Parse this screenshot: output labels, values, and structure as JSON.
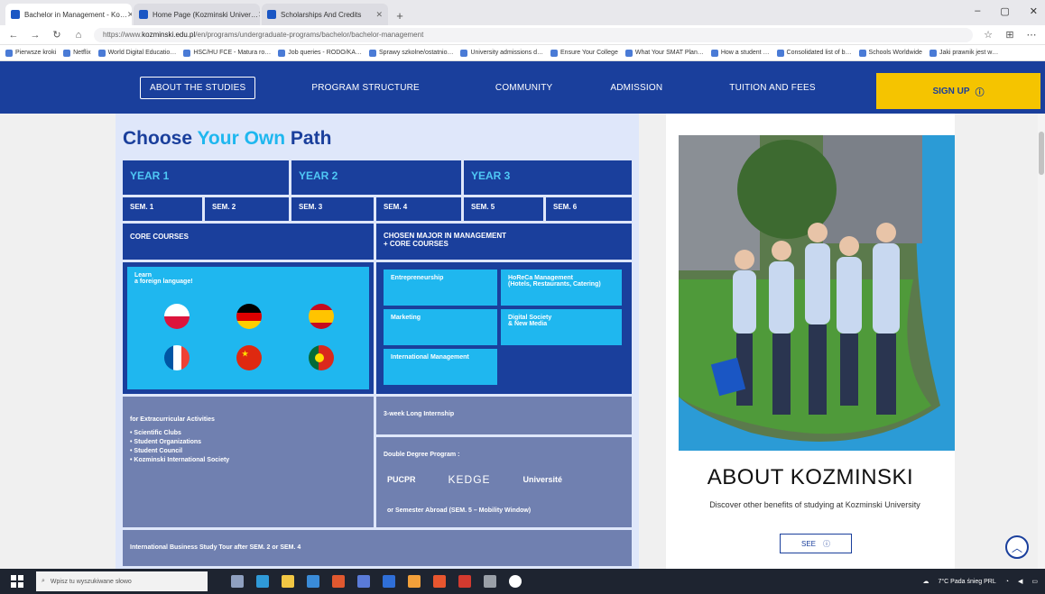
{
  "browser": {
    "tabs": [
      {
        "label": "Bachelor in Management - Ko…",
        "active": true
      },
      {
        "label": "Home Page (Kozminski Univer…",
        "active": false
      },
      {
        "label": "Scholarships And Credits",
        "active": false
      }
    ],
    "url_prefix": "https://www.",
    "url_domain": "kozminski.edu.pl",
    "url_path": "/en/programs/undergraduate-programs/bachelor/bachelor-management",
    "bookmarks": [
      "Pierwsze kroki",
      "Netflix",
      "World Digital Educatio…",
      "HSC/HU FCE - Matura ro…",
      "Job queries - RODO/KA…",
      "Sprawy szkolne/ostatnio…",
      "University admissions d…",
      "Ensure Your College",
      "What Your SMAT Plan…",
      "How a student …",
      "Consolidated list of b…",
      "Schools Worldwide",
      "Jaki prawnik jest w…"
    ]
  },
  "nav": {
    "items": [
      "ABOUT THE STUDIES",
      "PROGRAM STRUCTURE",
      "COMMUNITY",
      "ADMISSION",
      "TUITION AND FEES"
    ],
    "signup": "SIGN UP",
    "signup_icon": "info-circle-icon"
  },
  "path": {
    "title_a": "Choose ",
    "title_b": "Your Own",
    "title_c": " Path",
    "years": [
      "YEAR 1",
      "YEAR 2",
      "YEAR 3"
    ],
    "sems": [
      "SEM. 1",
      "SEM. 2",
      "SEM. 3",
      "SEM. 4",
      "SEM. 5",
      "SEM. 6"
    ],
    "core": "CORE COURSES",
    "major": "CHOSEN MAJOR IN MANAGEMENT\n+ CORE COURSES",
    "learn": "Learn\na foreign language!",
    "majors": [
      "Entrepreneurship",
      "HoReCa Management\n(Hotels, Restaurants, Catering)",
      "Marketing",
      "Digital Society\n& New Media",
      "International Management"
    ],
    "extra_title": "for Extracurricular Activities",
    "extra_items": [
      "• Scientific Clubs",
      "• Student Organizations",
      "• Student Council",
      "• Kozminski International Society"
    ],
    "internship": "3-week Long Internship",
    "double_degree": "Double Degree Program :",
    "logos": [
      "PUCPR",
      "KEDGE",
      "Université"
    ],
    "semester_abroad": "or Semester Abroad (SEM. 5 – Mobility Window)",
    "tour": "International Business Study Tour after SEM. 2 or SEM. 4"
  },
  "about": {
    "title": "ABOUT KOZMINSKI",
    "subtitle": "Discover other benefits of studying at Kozminski University",
    "see": "SEE"
  },
  "taskbar": {
    "search_placeholder": "Wpisz tu wyszukiwane słowo",
    "tray_text": "7°C Pada śnieg  PRL"
  },
  "colors": {
    "nav": "#1a3f9c",
    "accent": "#1fb7ef",
    "signup": "#f5c400"
  }
}
